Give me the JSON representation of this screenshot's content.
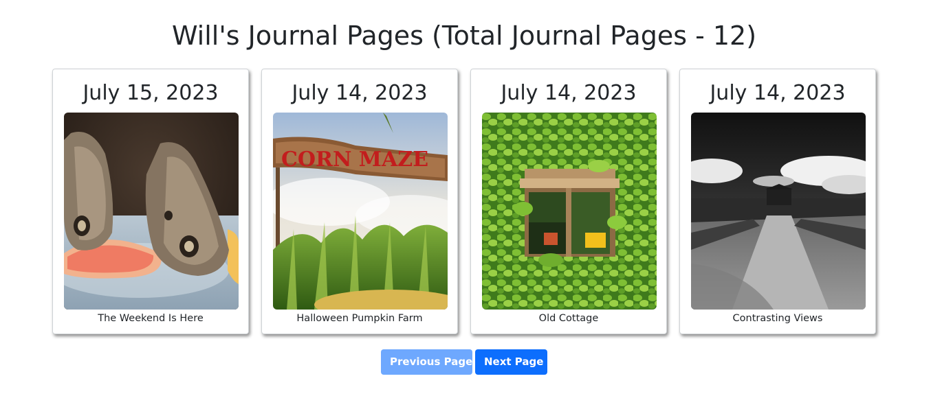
{
  "header": {
    "title": "Will's Journal Pages (Total Journal Pages - 12)"
  },
  "cards": [
    {
      "date": "July 15, 2023",
      "caption": "The Weekend Is Here",
      "image": "butterflies-on-grapefruit"
    },
    {
      "date": "July 14, 2023",
      "caption": "Halloween Pumpkin Farm",
      "image": "corn-maze-sign"
    },
    {
      "date": "July 14, 2023",
      "caption": "Old Cottage",
      "image": "ivy-covered-window"
    },
    {
      "date": "July 14, 2023",
      "caption": "Contrasting Views",
      "image": "black-white-fort-path"
    }
  ],
  "pagination": {
    "previous_label": "Previous Page",
    "next_label": "Next Page",
    "previous_disabled": true
  },
  "colors": {
    "primary": "#0d6efd",
    "primary_disabled": "#6ea8fe",
    "text": "#212529"
  }
}
